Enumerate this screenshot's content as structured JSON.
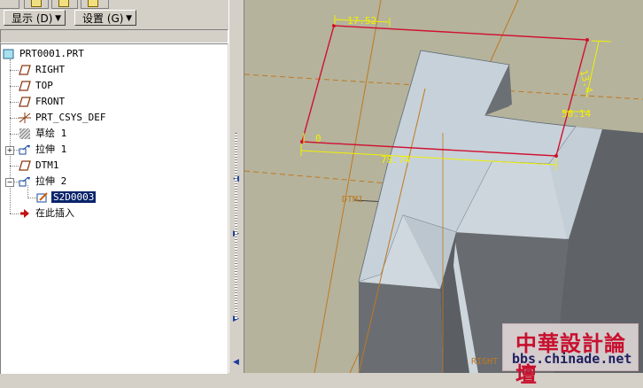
{
  "toolbar": {
    "show_label": "显示 (D)",
    "settings_label": "设置 (G)"
  },
  "tree": {
    "root": "PRT0001.PRT",
    "items": [
      {
        "label": "RIGHT",
        "icon": "datum-plane-icon"
      },
      {
        "label": "TOP",
        "icon": "datum-plane-icon"
      },
      {
        "label": "FRONT",
        "icon": "datum-plane-icon"
      },
      {
        "label": "PRT_CSYS_DEF",
        "icon": "coordinate-system-icon"
      },
      {
        "label": "草绘 1",
        "icon": "sketch-icon"
      },
      {
        "label": "拉伸 1",
        "icon": "extrude-icon"
      },
      {
        "label": "DTM1",
        "icon": "datum-plane-icon"
      },
      {
        "label": "拉伸 2",
        "icon": "extrude-icon"
      },
      {
        "label": "S2D0003",
        "icon": "sketch-edit-icon"
      },
      {
        "label": "在此插入",
        "icon": "insert-here-arrow-icon"
      }
    ]
  },
  "viewport": {
    "dimensions": [
      "17.52",
      "13.4",
      "50.14",
      "78.74",
      "0"
    ],
    "datum_labels": [
      "DTM1",
      "RIGHT"
    ]
  },
  "watermark": {
    "title": "中華設計論壇",
    "url": "bbs.chinade.net"
  },
  "colors": {
    "model_light": "#c7d1d9",
    "model_dark": "#6d7176",
    "sketch_red": "#d01030",
    "dimension_yellow": "#f0f000",
    "datum_orange": "#c07820",
    "background": "#b5b39c"
  }
}
